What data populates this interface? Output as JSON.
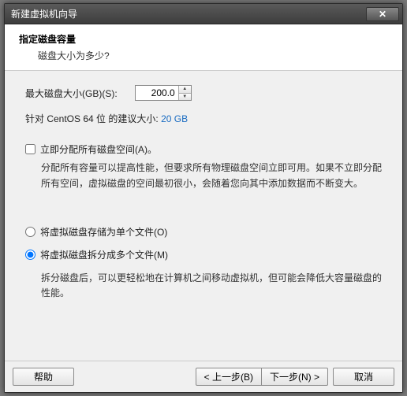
{
  "window": {
    "title": "新建虚拟机向导"
  },
  "header": {
    "title": "指定磁盘容量",
    "subtitle": "磁盘大小为多少?"
  },
  "disk": {
    "max_label": "最大磁盘大小(GB)(S):",
    "value": "200.0",
    "recommend_prefix": "针对 CentOS 64 位 的建议大小:",
    "recommend_size": "20 GB"
  },
  "allocate": {
    "label": "立即分配所有磁盘空间(A)。",
    "desc": "分配所有容量可以提高性能，但要求所有物理磁盘空间立即可用。如果不立即分配所有空间，虚拟磁盘的空间最初很小，会随着您向其中添加数据而不断变大。"
  },
  "storage": {
    "single": "将虚拟磁盘存储为单个文件(O)",
    "split": "将虚拟磁盘拆分成多个文件(M)",
    "split_desc": "拆分磁盘后，可以更轻松地在计算机之间移动虚拟机，但可能会降低大容量磁盘的性能。"
  },
  "buttons": {
    "help": "帮助",
    "back": "< 上一步(B)",
    "next": "下一步(N) >",
    "cancel": "取消"
  }
}
